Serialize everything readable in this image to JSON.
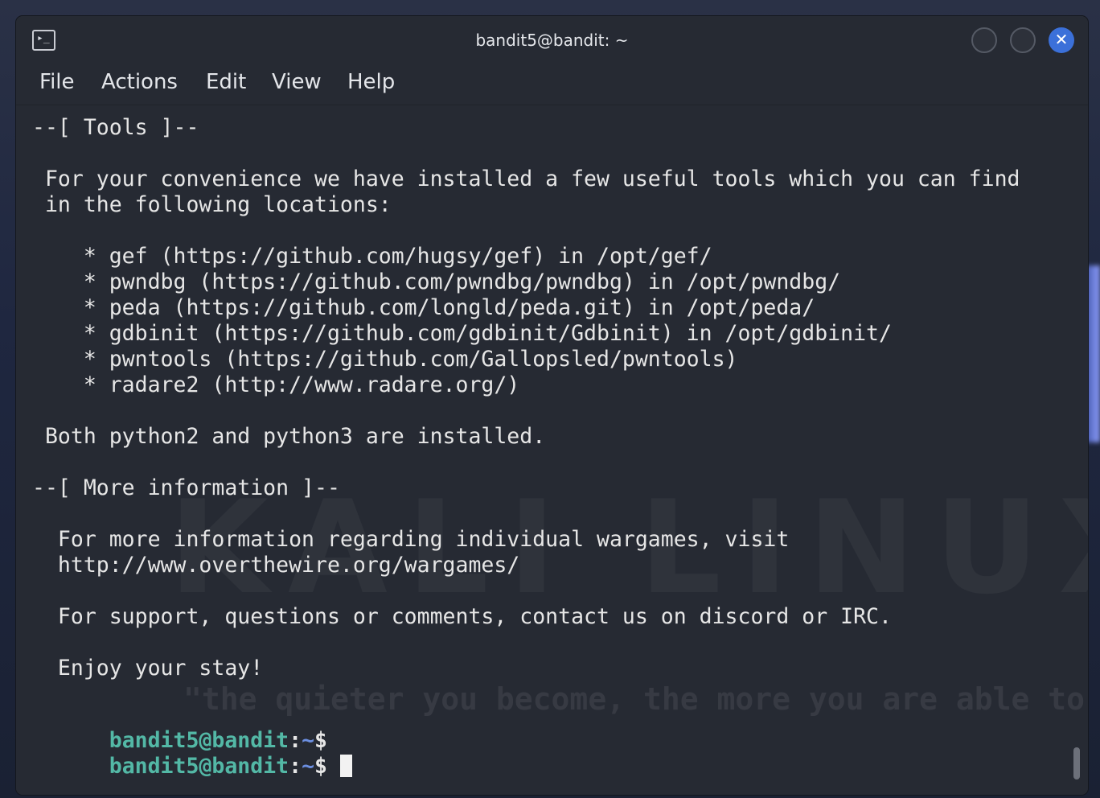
{
  "window": {
    "title": "bandit5@bandit: ~",
    "app_icon_glyph": "▸_",
    "close_glyph": "✕"
  },
  "menu": {
    "items": [
      "File",
      "Actions",
      "Edit",
      "View",
      "Help"
    ]
  },
  "terminal": {
    "lines": [
      "--[ Tools ]--",
      "",
      " For your convenience we have installed a few useful tools which you can find",
      " in the following locations:",
      "",
      "    * gef (https://github.com/hugsy/gef) in /opt/gef/",
      "    * pwndbg (https://github.com/pwndbg/pwndbg) in /opt/pwndbg/",
      "    * peda (https://github.com/longld/peda.git) in /opt/peda/",
      "    * gdbinit (https://github.com/gdbinit/Gdbinit) in /opt/gdbinit/",
      "    * pwntools (https://github.com/Gallopsled/pwntools)",
      "    * radare2 (http://www.radare.org/)",
      "",
      " Both python2 and python3 are installed.",
      "",
      "--[ More information ]--",
      "",
      "  For more information regarding individual wargames, visit",
      "  http://www.overthewire.org/wargames/",
      "",
      "  For support, questions or comments, contact us on discord or IRC.",
      "",
      "  Enjoy your stay!",
      ""
    ],
    "prompt": {
      "user_host": "bandit5@bandit",
      "colon": ":",
      "path": "~",
      "sign": "$"
    },
    "prompt_count": 2
  },
  "background": {
    "watermark": "KALI LINUX",
    "tagline": "\"the quieter you become, the more you are able to hear\""
  },
  "colors": {
    "terminal_bg": "#262a33",
    "text": "#e6e6e6",
    "prompt_user": "#53b8a6",
    "prompt_path": "#6b8ee0",
    "close_button": "#3b70d9"
  }
}
